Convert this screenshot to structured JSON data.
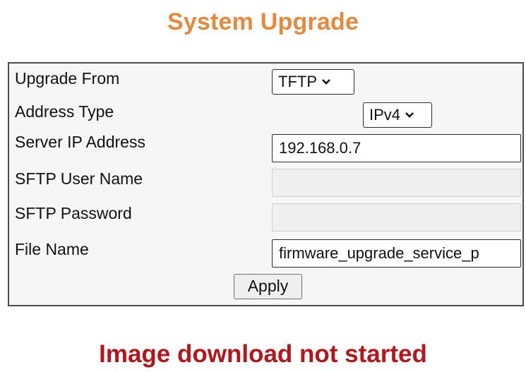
{
  "page": {
    "title": "System Upgrade"
  },
  "form": {
    "upgrade_from": {
      "label": "Upgrade From",
      "selected": "TFTP"
    },
    "address_type": {
      "label": "Address Type",
      "selected": "IPv4"
    },
    "server_ip": {
      "label": "Server IP Address",
      "value": "192.168.0.7"
    },
    "sftp_user": {
      "label": "SFTP User Name",
      "value": ""
    },
    "sftp_password": {
      "label": "SFTP Password",
      "value": ""
    },
    "file_name": {
      "label": "File Name",
      "value": "firmware_upgrade_service_p"
    },
    "apply_label": "Apply"
  },
  "status": {
    "message": "Image download not started"
  },
  "colors": {
    "title": "#e7893d",
    "status": "#b4161b",
    "border": "#4a4a4a"
  },
  "icons": {
    "dropdown": "chevron-down-icon"
  }
}
